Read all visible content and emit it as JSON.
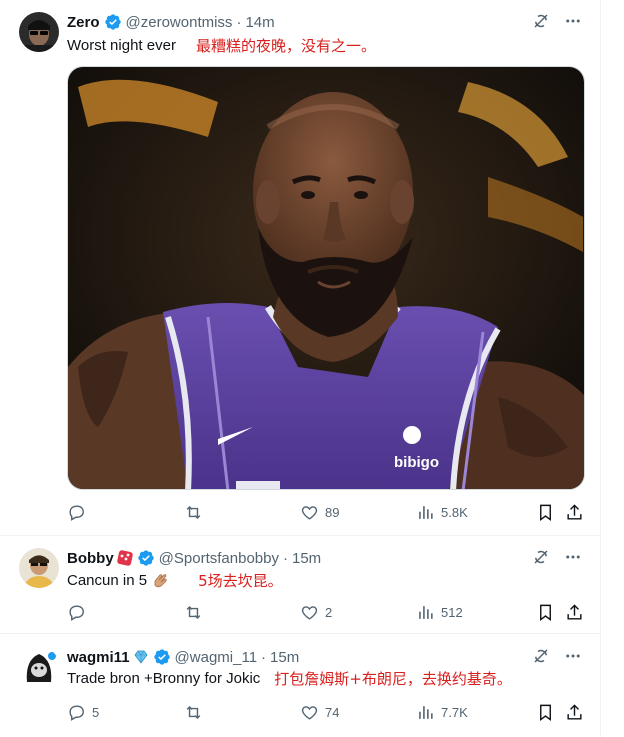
{
  "tweets": [
    {
      "name": "Zero",
      "handle": "@zerowontmiss",
      "time": "14m",
      "text": "Worst night ever",
      "translation": "最糟糕的夜晚，没有之一。",
      "stats": {
        "replies": "",
        "retweets": "",
        "likes": "89",
        "views": "5.8K"
      }
    },
    {
      "name": "Bobby",
      "handle": "@Sportsfanbobby",
      "time": "15m",
      "text": "Cancun in 5",
      "translation": "5场去坎昆。",
      "stats": {
        "replies": "",
        "retweets": "",
        "likes": "2",
        "views": "512"
      }
    },
    {
      "name": "wagmi11",
      "handle": "@wagmi_11",
      "time": "15m",
      "text": "Trade bron +Bronny for Jokic",
      "translation": "打包詹姆斯+布朗尼，去换约基奇。",
      "stats": {
        "replies": "5",
        "retweets": "",
        "likes": "74",
        "views": "7.7K"
      }
    }
  ],
  "separator": "·",
  "icons": {
    "verified": "verified-badge-icon",
    "grok": "grok-icon",
    "more": "more-icon",
    "reply": "reply-icon",
    "retweet": "retweet-icon",
    "like": "like-icon",
    "views": "views-icon",
    "bookmark": "bookmark-icon",
    "share": "share-icon"
  },
  "colors": {
    "verified": "#1d9bf0",
    "translation": "#d8201e",
    "meta": "#536471"
  }
}
